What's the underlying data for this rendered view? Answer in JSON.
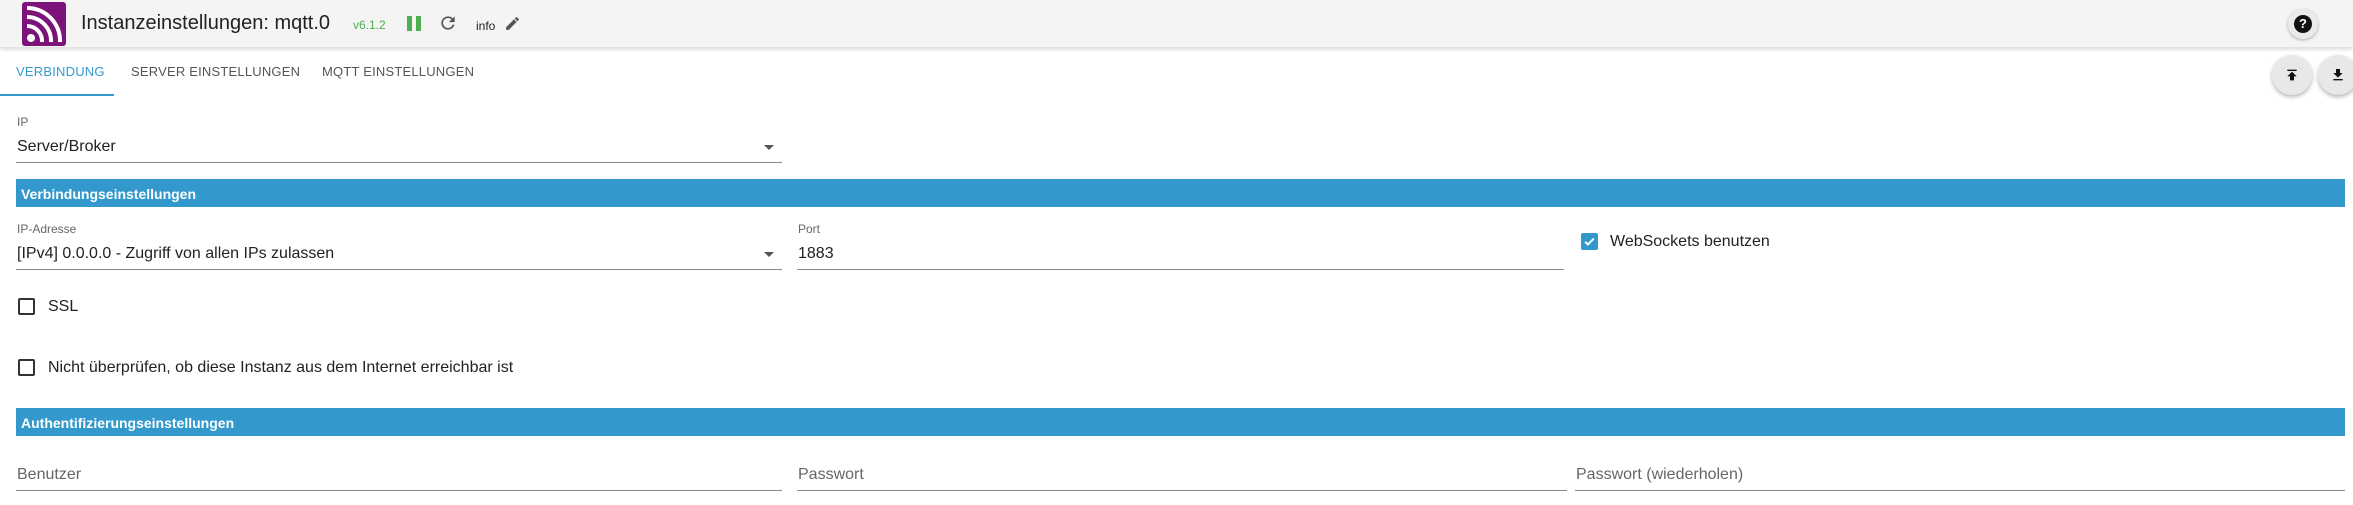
{
  "header": {
    "title": "Instanzeinstellungen: mqtt.0",
    "version": "v6.1.2",
    "info": "info",
    "icons": [
      "app-logo-icon",
      "pause-icon",
      "reload-icon",
      "pencil-icon",
      "help-icon"
    ]
  },
  "tabs": [
    {
      "label": "Verbindung",
      "active": true
    },
    {
      "label": "Server Einstellungen",
      "active": false
    },
    {
      "label": "MQTT Einstellungen",
      "active": false
    }
  ],
  "toolbar": {
    "upload_icon": "upload-icon",
    "download_icon": "download-icon"
  },
  "form": {
    "ip_type": {
      "label": "IP",
      "value": "Server/Broker"
    },
    "section_connection": "Verbindungseinstellungen",
    "ip_address": {
      "label": "IP-Adresse",
      "value": "[IPv4] 0.0.0.0 - Zugriff von allen IPs zulassen"
    },
    "port": {
      "label": "Port",
      "value": "1883"
    },
    "websockets": {
      "label": "WebSockets benutzen",
      "checked": true
    },
    "ssl": {
      "label": "SSL",
      "checked": false
    },
    "no_check": {
      "label": "Nicht überprüfen, ob diese Instanz aus dem Internet erreichbar ist",
      "checked": false
    },
    "section_auth": "Authentifizierungseinstellungen",
    "user": {
      "placeholder": "Benutzer"
    },
    "password": {
      "placeholder": "Passwort"
    },
    "password_repeat": {
      "placeholder": "Passwort (wiederholen)"
    }
  },
  "colors": {
    "accent": "#3399cc",
    "status_green": "#4caf50",
    "logo_purple": "#7b1378"
  }
}
